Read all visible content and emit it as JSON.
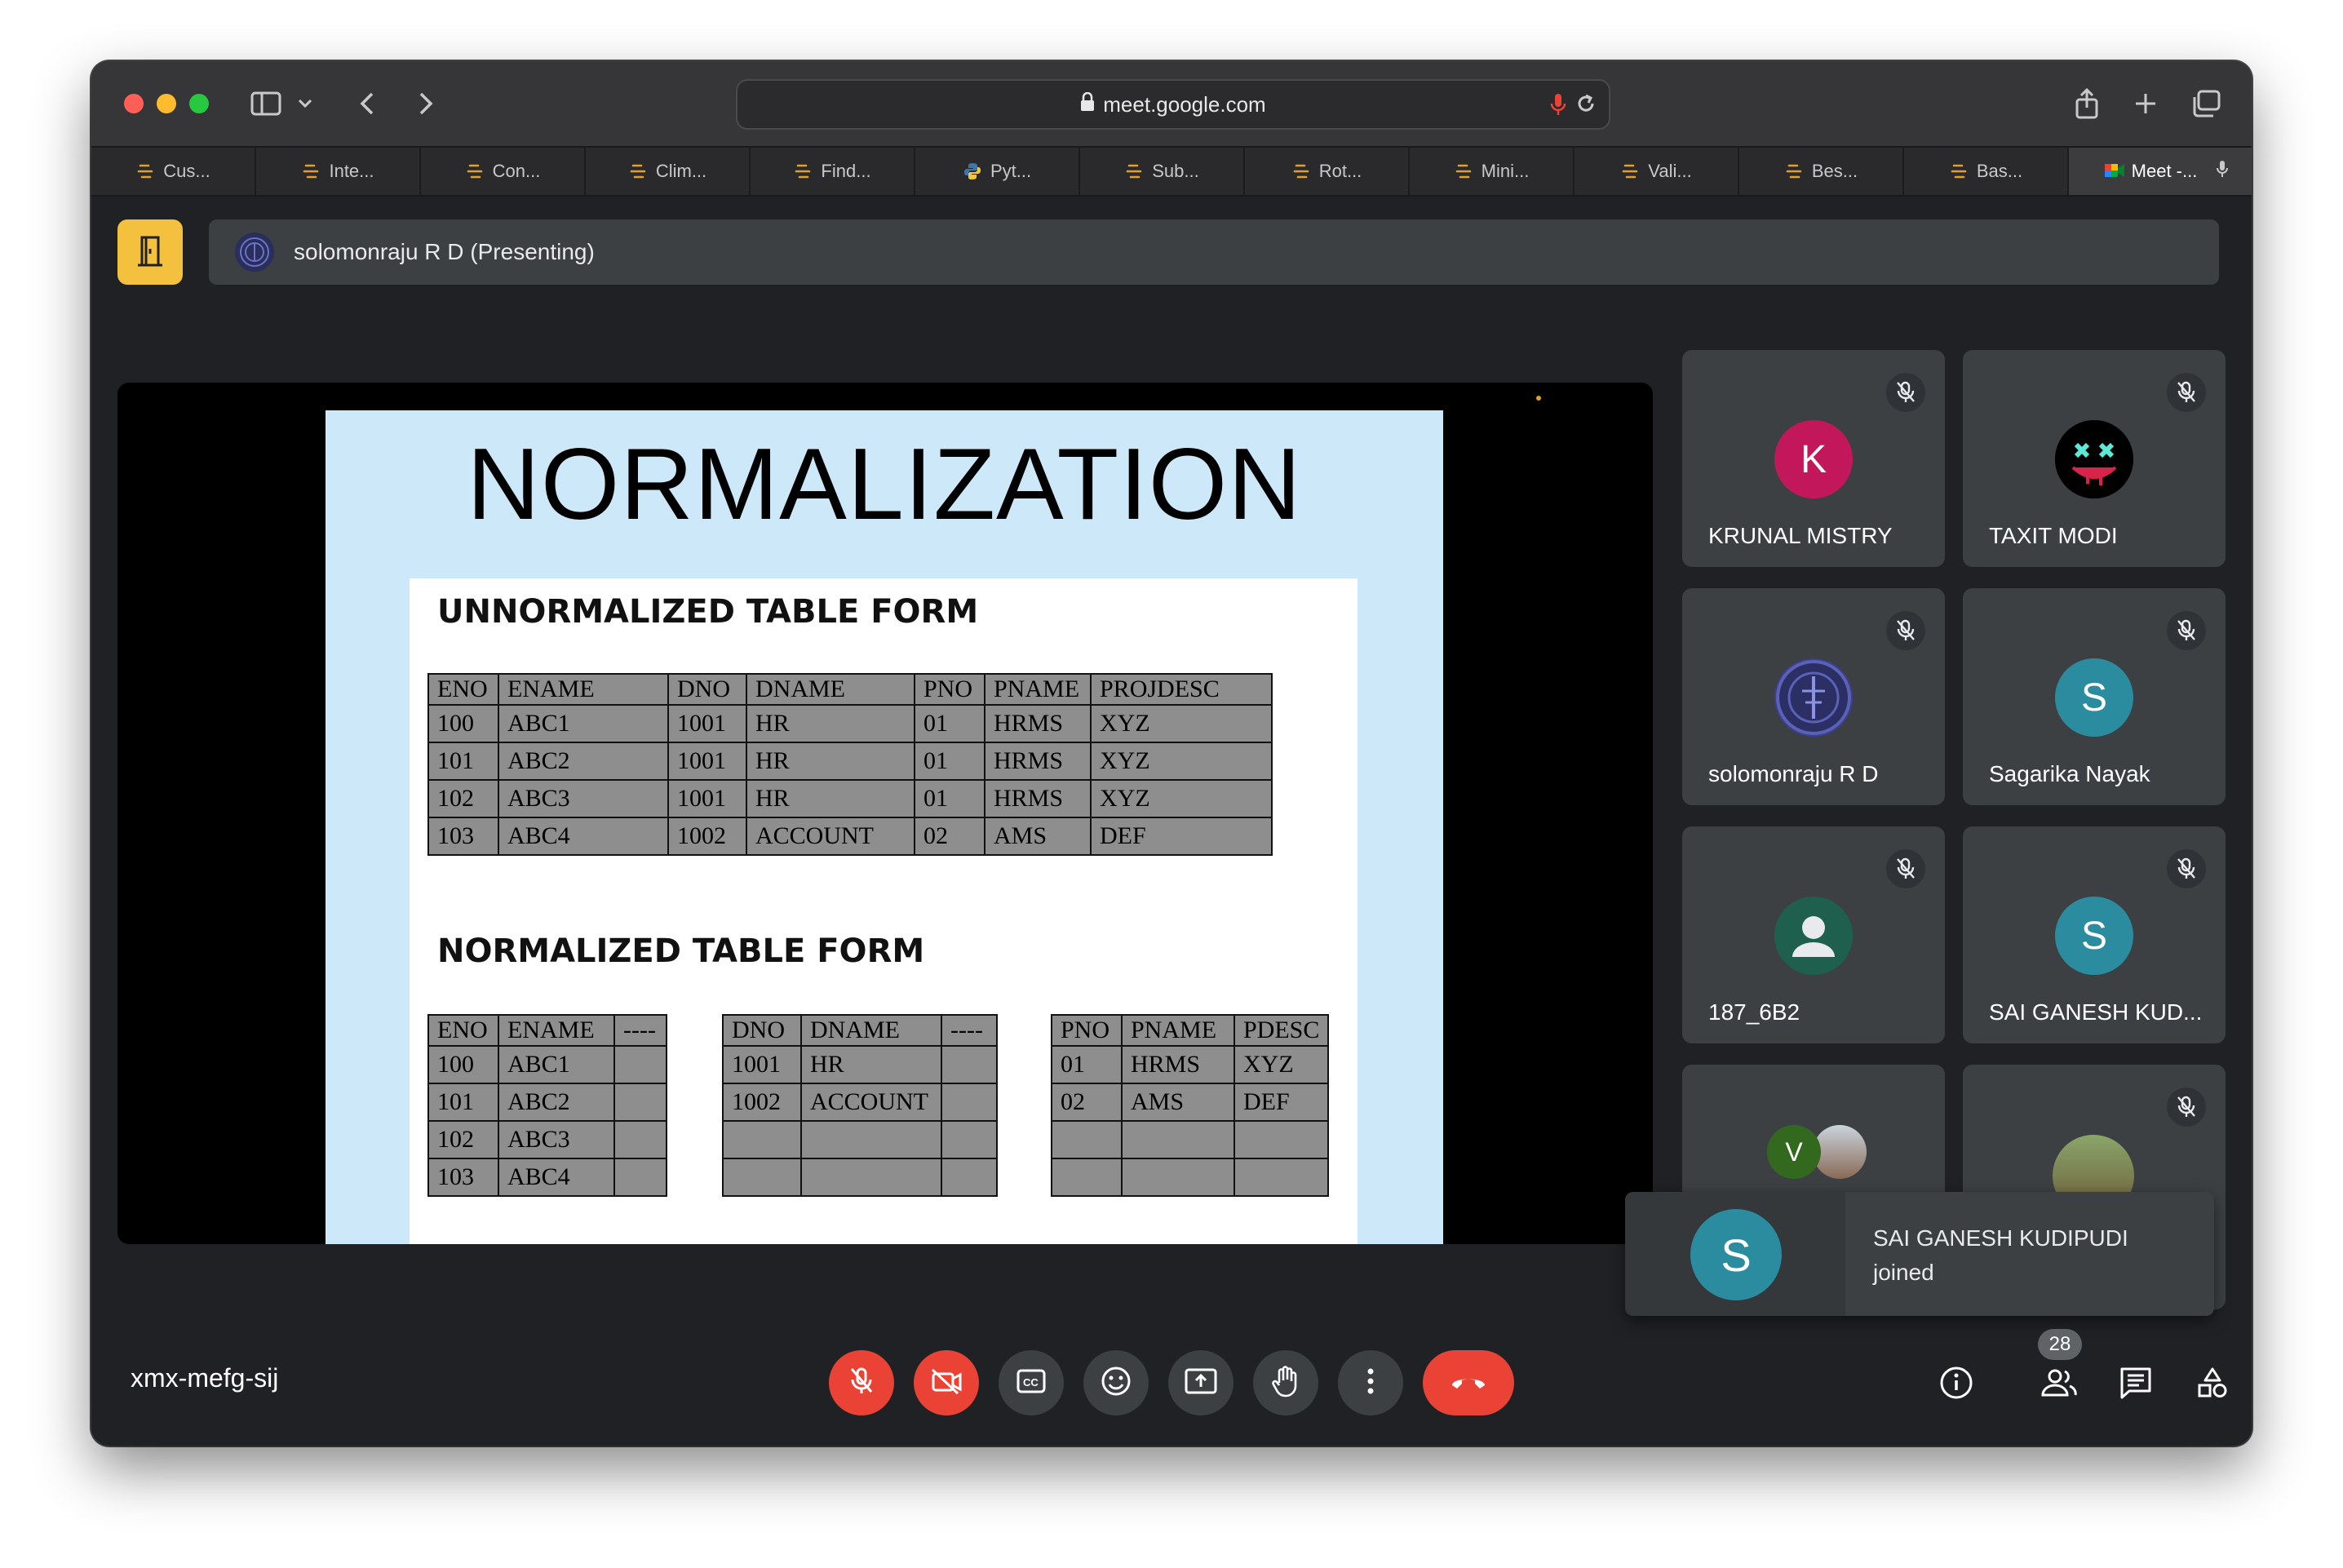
{
  "browser": {
    "url": "meet.google.com",
    "tabs": [
      {
        "label": "Cus...",
        "icon": "flow-icon"
      },
      {
        "label": "Inte...",
        "icon": "flow-icon"
      },
      {
        "label": "Con...",
        "icon": "flow-icon"
      },
      {
        "label": "Clim...",
        "icon": "flow-icon"
      },
      {
        "label": "Find...",
        "icon": "flow-icon"
      },
      {
        "label": "Pyt...",
        "icon": "python-icon"
      },
      {
        "label": "Sub...",
        "icon": "flow-icon"
      },
      {
        "label": "Rot...",
        "icon": "flow-icon"
      },
      {
        "label": "Mini...",
        "icon": "flow-icon"
      },
      {
        "label": "Vali...",
        "icon": "flow-icon"
      },
      {
        "label": "Bes...",
        "icon": "flow-icon"
      },
      {
        "label": "Bas...",
        "icon": "flow-icon"
      },
      {
        "label": "Meet -...",
        "icon": "meet-icon",
        "active": true
      }
    ]
  },
  "meet": {
    "presenter_label": "solomonraju R D (Presenting)",
    "meeting_code": "xmx-mefg-sij",
    "participant_count": "28",
    "toast": {
      "initial": "S",
      "name": "SAI GANESH KUDIPUDI",
      "status": "joined"
    }
  },
  "slide": {
    "title": "NORMALIZATION",
    "unnormalized_heading": "UNNORMALIZED TABLE FORM",
    "normalized_heading": "NORMALIZED TABLE FORM",
    "unnormalized_table": {
      "headers": [
        "ENO",
        "ENAME",
        "DNO",
        "DNAME",
        "PNO",
        "PNAME",
        "PROJDESC"
      ],
      "rows": [
        [
          "100",
          "ABC1",
          "1001",
          "HR",
          "01",
          "HRMS",
          "XYZ"
        ],
        [
          "101",
          "ABC2",
          "1001",
          "HR",
          "01",
          "HRMS",
          "XYZ"
        ],
        [
          "102",
          "ABC3",
          "1001",
          "HR",
          "01",
          "HRMS",
          "XYZ"
        ],
        [
          "103",
          "ABC4",
          "1002",
          "ACCOUNT",
          "02",
          "AMS",
          "DEF"
        ]
      ]
    },
    "emp_table": {
      "headers": [
        "ENO",
        "ENAME",
        "----"
      ],
      "rows": [
        [
          "100",
          "ABC1",
          ""
        ],
        [
          "101",
          "ABC2",
          ""
        ],
        [
          "102",
          "ABC3",
          ""
        ],
        [
          "103",
          "ABC4",
          ""
        ]
      ]
    },
    "dept_table": {
      "headers": [
        "DNO",
        "DNAME",
        "----"
      ],
      "rows": [
        [
          "1001",
          "HR",
          ""
        ],
        [
          "1002",
          "ACCOUNT",
          ""
        ],
        [
          "",
          "",
          ""
        ],
        [
          "",
          "",
          ""
        ]
      ]
    },
    "proj_table": {
      "headers": [
        "PNO",
        "PNAME",
        "PDESC"
      ],
      "rows": [
        [
          "01",
          "HRMS",
          "XYZ"
        ],
        [
          "02",
          "AMS",
          "DEF"
        ],
        [
          "",
          "",
          ""
        ],
        [
          "",
          "",
          ""
        ]
      ]
    }
  },
  "participants": [
    {
      "name": "KRUNAL MISTRY",
      "initial": "K",
      "color": "#c2185b"
    },
    {
      "name": "TAXIT MODI",
      "initial": "",
      "color": "#000000"
    },
    {
      "name": "solomonraju R D",
      "initial": "",
      "color": "#3a3f8f"
    },
    {
      "name": "Sagarika Nayak",
      "initial": "S",
      "color": "#2b8ca0"
    },
    {
      "name": "187_6B2",
      "initial": "",
      "color": "#1e5f4e"
    },
    {
      "name": "SAI GANESH KUD...",
      "initial": "S",
      "color": "#2b8ca0"
    },
    {
      "name": "",
      "initial": "V",
      "color": "#33691e"
    },
    {
      "name": "",
      "initial": "",
      "color": "#6d5c3a"
    }
  ],
  "colors": {
    "accent_red": "#ea4335",
    "host_yellow": "#f4c13f",
    "tile_bg": "#3c4043"
  }
}
